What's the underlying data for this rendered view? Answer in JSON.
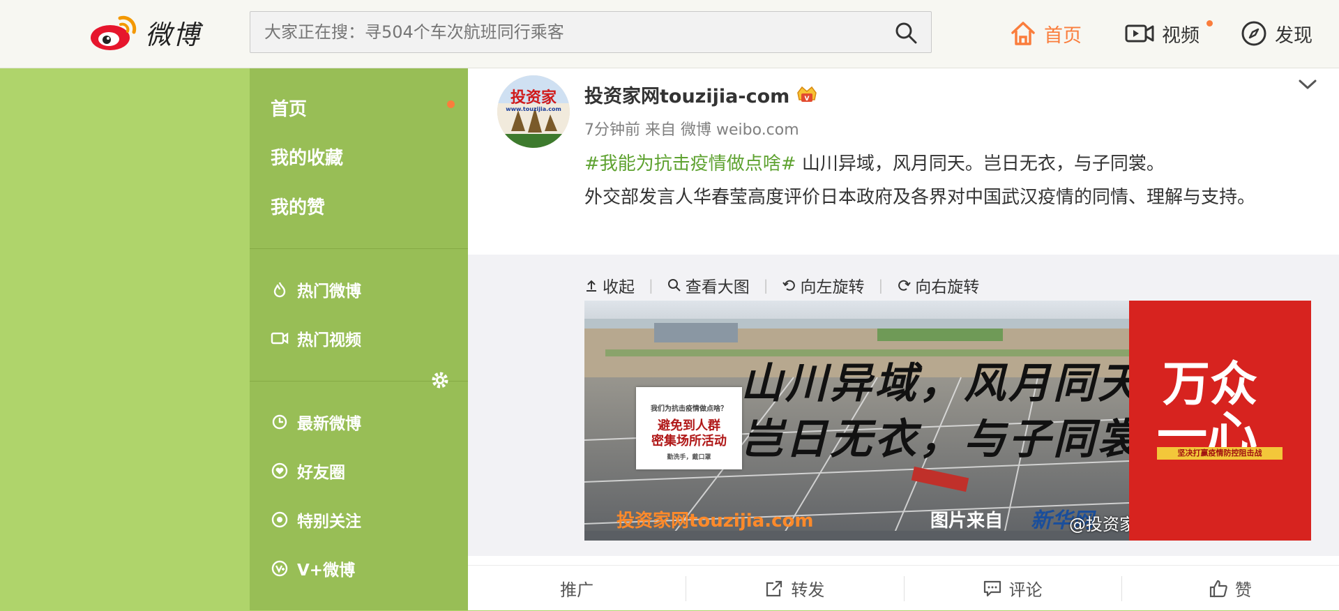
{
  "header": {
    "logo_text": "微博",
    "search_placeholder": "大家正在搜：寻504个车次航班同行乘客",
    "nav": {
      "home": "首页",
      "video": "视频",
      "discover": "发现"
    }
  },
  "sidebar": {
    "primary": [
      "首页",
      "我的收藏",
      "我的赞"
    ],
    "hot": [
      "热门微博",
      "热门视频"
    ],
    "groups": [
      "最新微博",
      "好友圈",
      "特别关注",
      "V+微博"
    ]
  },
  "post": {
    "avatar_label": "投资家",
    "avatar_sub": "www.touzijia.com",
    "username": "投资家网touzijia-com",
    "time": "7分钟前",
    "from_label": "来自",
    "source": "微博 weibo.com",
    "topic": "#我能为抗击疫情做点啥#",
    "text_line1": " 山川异域，风月同天。岂日无衣，与子同裳。",
    "text_line2": "外交部发言人华春莹高度评价日本政府及各界对中国武汉疫情的同情、理解与支持。",
    "media_tools": [
      "收起",
      "查看大图",
      "向左旋转",
      "向右旋转"
    ],
    "image": {
      "calligraphy_line1": "山川异域，风月同天",
      "calligraphy_line2": "岂日无衣，与子同裳",
      "poster_line1": "我们为抗击疫情做点啥？",
      "poster_line2": "避免到人群\n密集场所活动",
      "poster_line3": "勤洗手，戴口罩",
      "watermark": "投资家网touzijia.com",
      "credit": "图片来自",
      "xinhua": "新华网",
      "weibo_watermark": "@投资家网touzijia-com",
      "red_title1": "万众",
      "red_title2": "一心",
      "red_banner": "坚决打赢疫情防控阻击战"
    },
    "actions": [
      "推广",
      "转发",
      "评论",
      "赞"
    ]
  },
  "colors": {
    "accent": "#fa7d3c",
    "sidebar": "#98be56",
    "background": "#afd46b",
    "topic": "#5ea230"
  }
}
